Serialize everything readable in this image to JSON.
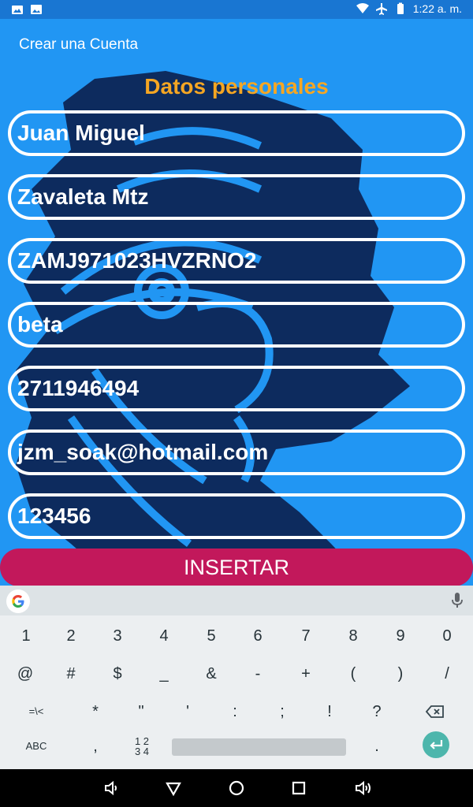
{
  "status_bar": {
    "time": "1:22 a. m.",
    "icons": [
      "gallery-icon",
      "image-icon",
      "wifi-icon",
      "airplane-icon",
      "battery-icon"
    ]
  },
  "app_bar": {
    "title": "Crear una Cuenta"
  },
  "form": {
    "section_title": "Datos personales",
    "fields": [
      {
        "name": "first-name-field",
        "value": "Juan Miguel"
      },
      {
        "name": "last-name-field",
        "value": "Zavaleta Mtz"
      },
      {
        "name": "curp-field",
        "value": "ZAMJ971023HVZRNO2"
      },
      {
        "name": "username-field",
        "value": "beta"
      },
      {
        "name": "phone-field",
        "value": "2711946494"
      },
      {
        "name": "email-field",
        "value": "jzm_soak@hotmail.com"
      },
      {
        "name": "password-field",
        "value": "123456"
      }
    ],
    "insert_label": "INSERTAR"
  },
  "keyboard": {
    "row1": [
      "1",
      "2",
      "3",
      "4",
      "5",
      "6",
      "7",
      "8",
      "9",
      "0"
    ],
    "row2": [
      "@",
      "#",
      "$",
      "_",
      "&",
      "-",
      "+",
      "(",
      ")",
      "/"
    ],
    "row3": [
      "=\\<",
      "*",
      "\"",
      "'",
      ":",
      ";",
      "!",
      "?"
    ],
    "row4": {
      "abc": "ABC",
      "comma": ",",
      "numpad": "1 2\n3 4",
      "period": "."
    }
  },
  "colors": {
    "primary": "#2196F3",
    "status_bar": "#1976D2",
    "accent_title": "#F5A623",
    "button": "#C2185B"
  }
}
